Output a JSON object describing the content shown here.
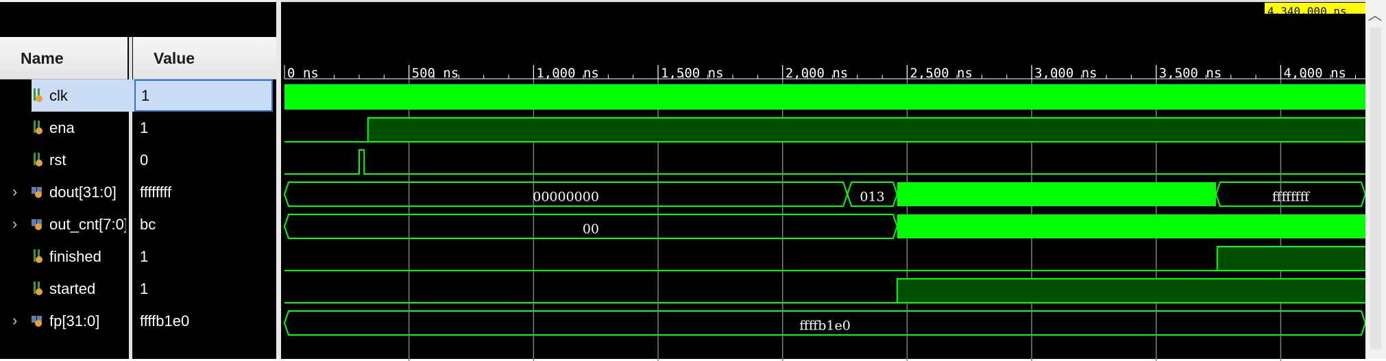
{
  "headers": {
    "name": "Name",
    "value": "Value"
  },
  "signals": [
    {
      "name": "clk",
      "value": "1",
      "type": "bit",
      "expandable": false,
      "selected": true
    },
    {
      "name": "ena",
      "value": "1",
      "type": "bit",
      "expandable": false,
      "selected": false
    },
    {
      "name": "rst",
      "value": "0",
      "type": "bit",
      "expandable": false,
      "selected": false
    },
    {
      "name": "dout[31:0]",
      "value": "ffffffff",
      "type": "bus",
      "expandable": true,
      "selected": false
    },
    {
      "name": "out_cnt[7:0]",
      "value": "bc",
      "type": "bus",
      "expandable": true,
      "selected": false
    },
    {
      "name": "finished",
      "value": "1",
      "type": "bit",
      "expandable": false,
      "selected": false
    },
    {
      "name": "started",
      "value": "1",
      "type": "bit",
      "expandable": false,
      "selected": false
    },
    {
      "name": "fp[31:0]",
      "value": "ffffb1e0",
      "type": "bus",
      "expandable": true,
      "selected": false
    }
  ],
  "timeline": {
    "range_ns": [
      0,
      4340
    ],
    "ticks": [
      {
        "t": 0,
        "label": "0 ns"
      },
      {
        "t": 500,
        "label": "500 ns"
      },
      {
        "t": 1000,
        "label": "1,000 ns"
      },
      {
        "t": 1500,
        "label": "1,500 ns"
      },
      {
        "t": 2000,
        "label": "2,000 ns"
      },
      {
        "t": 2500,
        "label": "2,500 ns"
      },
      {
        "t": 3000,
        "label": "3,000 ns"
      },
      {
        "t": 3500,
        "label": "3,500 ns"
      },
      {
        "t": 4000,
        "label": "4,000 ns"
      }
    ],
    "cursor_label": "4,340,000 ns"
  },
  "waves": {
    "ena": {
      "high_from_ns": 335
    },
    "rst": {
      "pulse_ns": [
        300,
        320
      ]
    },
    "dout": {
      "segments": [
        {
          "from": 0,
          "to": 2260,
          "label": "00000000"
        },
        {
          "from": 2260,
          "to": 2460,
          "label": "013"
        },
        {
          "from": 2460,
          "to": 3740,
          "label": "",
          "dense": true
        },
        {
          "from": 3740,
          "to": 4340,
          "label": "ffffffff"
        }
      ]
    },
    "out_cnt": {
      "segments": [
        {
          "from": 0,
          "to": 2460,
          "label": "00"
        },
        {
          "from": 2460,
          "to": 4340,
          "label": "",
          "dense": true
        }
      ]
    },
    "finished": {
      "high_from_ns": 3745
    },
    "started": {
      "high_from_ns": 2460
    },
    "fp": {
      "segments": [
        {
          "from": 0,
          "to": 4340,
          "label": "ffffb1e0"
        }
      ]
    }
  },
  "colors": {
    "wave": "#00ff00",
    "wave_fill": "#004d00",
    "background": "#000000",
    "grid": "#808080",
    "cursor": "#ffff00"
  },
  "icons": {
    "bit": "bit-signal-icon",
    "bus": "bus-signal-icon",
    "scroll_up": "chevron-up-icon",
    "expand": "chevron-right-icon"
  }
}
